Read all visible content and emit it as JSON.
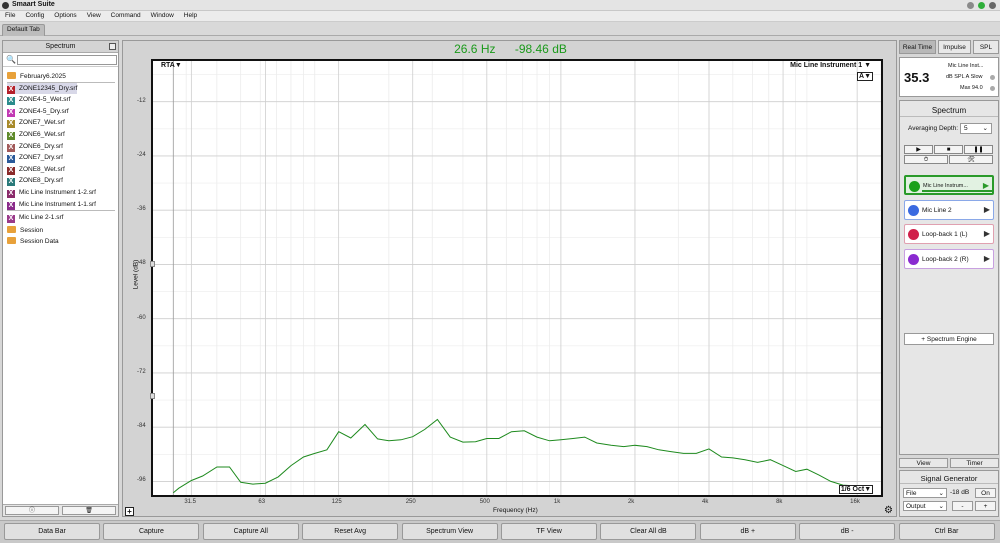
{
  "app": {
    "title": "Smaart Suite"
  },
  "menu": [
    "File",
    "Config",
    "Options",
    "View",
    "Command",
    "Window",
    "Help"
  ],
  "tab": {
    "label": "Default Tab"
  },
  "left_panel": {
    "title": "Spectrum",
    "search_placeholder": "",
    "footer": {
      "info": "ⓘ",
      "trash": "🗑"
    },
    "items": [
      {
        "type": "folder",
        "label": "February6.2025"
      },
      {
        "type": "file",
        "label": "ZONE12345_Dry.srf",
        "color": "#b4202a",
        "selected": true
      },
      {
        "type": "file",
        "label": "ZONE4-5_Wet.srf",
        "color": "#2a8c8c"
      },
      {
        "type": "file",
        "label": "ZONE4-5_Dry.srf",
        "color": "#c23ab4"
      },
      {
        "type": "file",
        "label": "ZONE7_Wet.srf",
        "color": "#a88a2a"
      },
      {
        "type": "file",
        "label": "ZONE6_Wet.srf",
        "color": "#5e8a2a"
      },
      {
        "type": "file",
        "label": "ZONE6_Dry.srf",
        "color": "#a25a5a"
      },
      {
        "type": "file",
        "label": "ZONE7_Dry.srf",
        "color": "#2a5a9a"
      },
      {
        "type": "file",
        "label": "ZONE8_Wet.srf",
        "color": "#8a2a2a"
      },
      {
        "type": "file",
        "label": "ZONE8_Dry.srf",
        "color": "#2a7a7a"
      },
      {
        "type": "file",
        "label": "Mic   Line   Instrument 1-2.srf",
        "color": "#8a2a6a"
      },
      {
        "type": "file",
        "label": "Mic   Line   Instrument 1-1.srf",
        "color": "#8a2a8a"
      },
      {
        "type": "file",
        "label": "Mic   Line 2-1.srf",
        "color": "#9a3a8a"
      },
      {
        "type": "folder",
        "label": "Session"
      },
      {
        "type": "folder",
        "label": "Session Data"
      }
    ]
  },
  "readout": {
    "frequency": "26.6 Hz",
    "level": "-98.46 dB"
  },
  "plot": {
    "top_left": "RTA",
    "top_right": "Mic   Line   Instrument 1",
    "a_button": "A",
    "oct_button": "1/6 Oct",
    "add_button": "+",
    "gear": "⚙"
  },
  "chart_data": {
    "type": "line",
    "xlabel": "Frequency (Hz)",
    "ylabel": "Level (dB)",
    "xscale": "log",
    "xlim": [
      22,
      20000
    ],
    "ylim": [
      -99,
      -3
    ],
    "x_tick_labels": [
      "31.5",
      "63",
      "125",
      "250",
      "500",
      "1k",
      "2k",
      "4k",
      "8k",
      "16k"
    ],
    "x_ticks": [
      31.5,
      63,
      125,
      250,
      500,
      1000,
      2000,
      4000,
      8000,
      16000
    ],
    "y_ticks": [
      -12,
      -24,
      -36,
      -48,
      -60,
      -72,
      -84,
      -96
    ],
    "grid": true,
    "series": [
      {
        "color": "#1e8a1e",
        "x": [
          26.6,
          28,
          31.5,
          35,
          40,
          45,
          50,
          56,
          63,
          71,
          80,
          90,
          100,
          112,
          125,
          140,
          160,
          180,
          200,
          224,
          250,
          280,
          315,
          355,
          400,
          450,
          500,
          560,
          630,
          710,
          800,
          900,
          1000,
          1120,
          1250,
          1400,
          1600,
          1800,
          2000,
          2240,
          2500,
          2800,
          3150,
          3550,
          4000,
          4500,
          5000,
          5600,
          6300,
          7100,
          8000,
          9000,
          10000,
          11200,
          12500,
          14000,
          16000
        ],
        "y": [
          -98.5,
          -97.5,
          -95.8,
          -94.8,
          -92.8,
          -92.8,
          -96.2,
          -96.6,
          -96.4,
          -95.0,
          -92.5,
          -90.6,
          -89.8,
          -89.0,
          -85.0,
          -86.4,
          -83.4,
          -86.6,
          -87.0,
          -86.8,
          -86.1,
          -84.5,
          -82.3,
          -86.2,
          -87.3,
          -87.2,
          -86.5,
          -86.5,
          -85.0,
          -84.8,
          -86.2,
          -87.0,
          -86.8,
          -86.5,
          -86.2,
          -87.5,
          -88.0,
          -88.3,
          -88.0,
          -88.3,
          -89.0,
          -89.4,
          -89.8,
          -89.8,
          -88.8,
          -90.6,
          -90.8,
          -91.2,
          -91.8,
          -91.2,
          -92.5,
          -93.8,
          -93.3,
          -94.6,
          -96.0,
          -96.8,
          -97.0
        ]
      }
    ]
  },
  "right_panel": {
    "tabs": [
      "Real Time",
      "Impulse",
      "SPL"
    ],
    "spl": {
      "value": "35.3",
      "source": "Mic   Line   Inst...",
      "mode": "dB SPL A Slow",
      "max": "Max 94.0"
    },
    "spectrum_title": "Spectrum",
    "averaging_label": "Averaging Depth:",
    "averaging_value": "5",
    "controls": {
      "play": "▶",
      "stop": "■",
      "pause": "❚❚",
      "timer": "⏱",
      "tools": "🛠"
    },
    "measurements": [
      {
        "label": "Mic   Line   Instrum...",
        "color": "#1aa01a",
        "active": true
      },
      {
        "label": "Mic   Line 2",
        "color": "#3a6ae0"
      },
      {
        "label": "Loop-back 1 (L)",
        "color": "#d0204a"
      },
      {
        "label": "Loop-back 2 (R)",
        "color": "#8a2ad0"
      }
    ],
    "add_engine": "+ Spectrum Engine",
    "bottom_tabs": [
      "View",
      "Timer"
    ],
    "signal_generator": {
      "title": "Signal Generator",
      "type": "File",
      "level": "-18 dB",
      "on": "On",
      "output": "Output",
      "minus": "-",
      "plus": "+"
    }
  },
  "toolbar": [
    "Data Bar",
    "Capture",
    "Capture All",
    "Reset Avg",
    "Spectrum View",
    "TF View",
    "Clear All dB",
    "dB +",
    "dB -",
    "Ctrl Bar"
  ]
}
